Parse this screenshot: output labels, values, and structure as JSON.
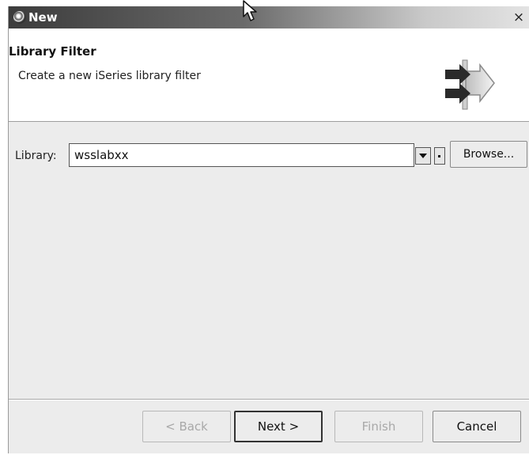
{
  "window": {
    "title": "New",
    "close_label": "×"
  },
  "banner": {
    "title": "Library Filter",
    "description": "Create a new iSeries library filter",
    "icon": "wizard-arrows-icon"
  },
  "form": {
    "library_label": "Library:",
    "library_value": "wsslabxx",
    "browse_label": "Browse..."
  },
  "buttons": {
    "back": "< Back",
    "next": "Next >",
    "finish": "Finish",
    "cancel": "Cancel"
  }
}
